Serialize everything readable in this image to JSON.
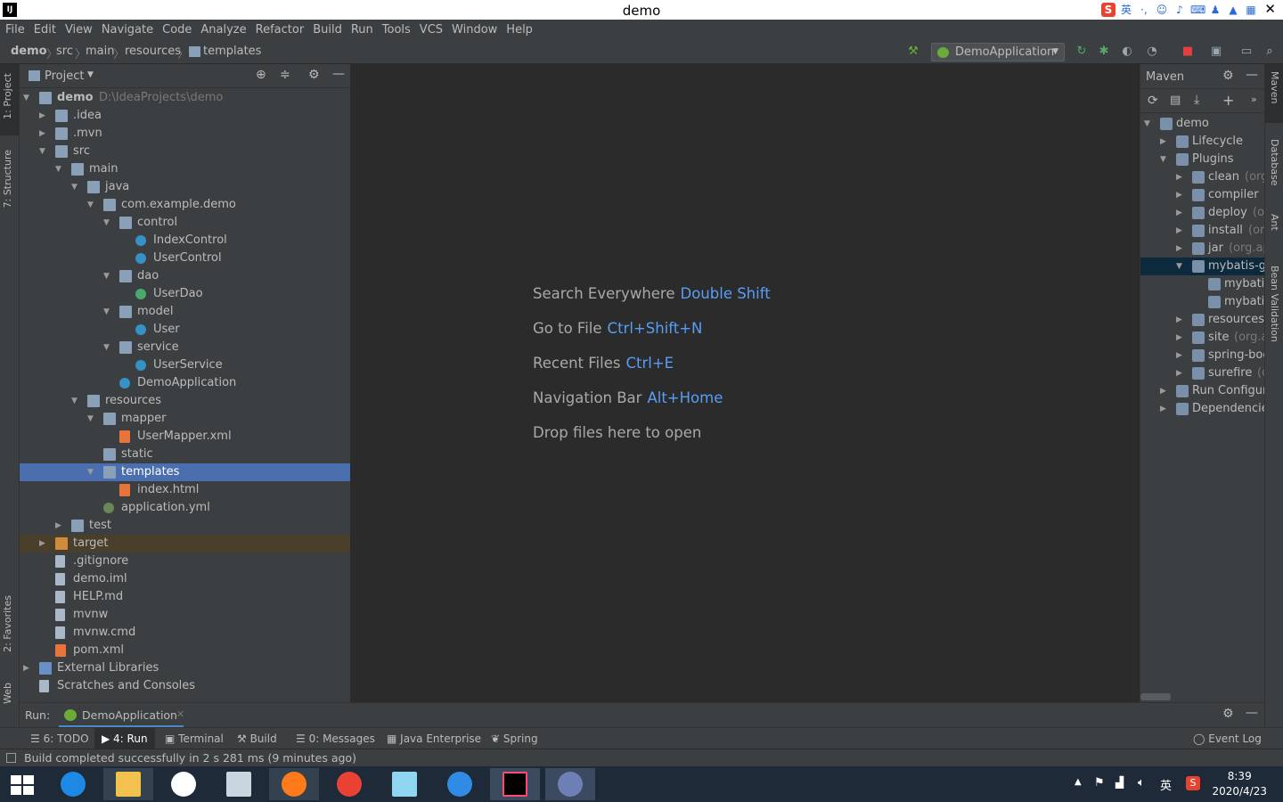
{
  "window": {
    "title": "demo"
  },
  "menu": [
    "File",
    "Edit",
    "View",
    "Navigate",
    "Code",
    "Analyze",
    "Refactor",
    "Build",
    "Run",
    "Tools",
    "VCS",
    "Window",
    "Help"
  ],
  "breadcrumb": [
    "demo",
    "src",
    "main",
    "resources",
    "templates"
  ],
  "run_config": "DemoApplication",
  "left_tabs": {
    "project": "1: Project",
    "structure": "7: Structure",
    "favorites": "2: Favorites",
    "web": "Web"
  },
  "project_panel": {
    "title": "Project",
    "tree": [
      {
        "label": "demo",
        "extra": "D:\\IdeaProjects\\demo",
        "depth": 0,
        "open": true,
        "type": "module"
      },
      {
        "label": ".idea",
        "depth": 1,
        "open": false,
        "type": "folder"
      },
      {
        "label": ".mvn",
        "depth": 1,
        "open": false,
        "type": "folder"
      },
      {
        "label": "src",
        "depth": 1,
        "open": true,
        "type": "folder"
      },
      {
        "label": "main",
        "depth": 2,
        "open": true,
        "type": "folder"
      },
      {
        "label": "java",
        "depth": 3,
        "open": true,
        "type": "folder"
      },
      {
        "label": "com.example.demo",
        "depth": 4,
        "open": true,
        "type": "folder"
      },
      {
        "label": "control",
        "depth": 5,
        "open": true,
        "type": "folder"
      },
      {
        "label": "IndexControl",
        "depth": 6,
        "type": "class"
      },
      {
        "label": "UserControl",
        "depth": 6,
        "type": "class"
      },
      {
        "label": "dao",
        "depth": 5,
        "open": true,
        "type": "folder"
      },
      {
        "label": "UserDao",
        "depth": 6,
        "type": "iface"
      },
      {
        "label": "model",
        "depth": 5,
        "open": true,
        "type": "folder"
      },
      {
        "label": "User",
        "depth": 6,
        "type": "class"
      },
      {
        "label": "service",
        "depth": 5,
        "open": true,
        "type": "folder"
      },
      {
        "label": "UserService",
        "depth": 6,
        "type": "class"
      },
      {
        "label": "DemoApplication",
        "depth": 5,
        "type": "class"
      },
      {
        "label": "resources",
        "depth": 3,
        "open": true,
        "type": "folder"
      },
      {
        "label": "mapper",
        "depth": 4,
        "open": true,
        "type": "folder"
      },
      {
        "label": "UserMapper.xml",
        "depth": 5,
        "type": "xml"
      },
      {
        "label": "static",
        "depth": 4,
        "type": "folder"
      },
      {
        "label": "templates",
        "depth": 4,
        "open": true,
        "type": "folder",
        "selected": true
      },
      {
        "label": "index.html",
        "depth": 5,
        "type": "html"
      },
      {
        "label": "application.yml",
        "depth": 4,
        "type": "yml"
      },
      {
        "label": "test",
        "depth": 2,
        "open": false,
        "type": "folder"
      },
      {
        "label": "target",
        "depth": 1,
        "open": false,
        "type": "folder-orange",
        "excluded": true
      },
      {
        "label": ".gitignore",
        "depth": 1,
        "type": "file"
      },
      {
        "label": "demo.iml",
        "depth": 1,
        "type": "file"
      },
      {
        "label": "HELP.md",
        "depth": 1,
        "type": "file"
      },
      {
        "label": "mvnw",
        "depth": 1,
        "type": "file"
      },
      {
        "label": "mvnw.cmd",
        "depth": 1,
        "type": "file"
      },
      {
        "label": "pom.xml",
        "depth": 1,
        "type": "xml"
      },
      {
        "label": "External Libraries",
        "depth": 0,
        "open": false,
        "type": "lib"
      },
      {
        "label": "Scratches and Consoles",
        "depth": 0,
        "type": "file"
      }
    ]
  },
  "editor_hints": [
    {
      "text": "Search Everywhere",
      "key": "Double Shift"
    },
    {
      "text": "Go to File",
      "key": "Ctrl+Shift+N"
    },
    {
      "text": "Recent Files",
      "key": "Ctrl+E"
    },
    {
      "text": "Navigation Bar",
      "key": "Alt+Home"
    },
    {
      "text": "Drop files here to open",
      "key": ""
    }
  ],
  "maven": {
    "title": "Maven",
    "tree": [
      {
        "label": "demo",
        "depth": 0,
        "open": true
      },
      {
        "label": "Lifecycle",
        "depth": 1,
        "open": false
      },
      {
        "label": "Plugins",
        "depth": 1,
        "open": true
      },
      {
        "label": "clean",
        "extra": "(org.",
        "depth": 2,
        "open": false
      },
      {
        "label": "compiler",
        "extra": "(c",
        "depth": 2,
        "open": false
      },
      {
        "label": "deploy",
        "extra": "(or",
        "depth": 2,
        "open": false
      },
      {
        "label": "install",
        "extra": "(org.",
        "depth": 2,
        "open": false
      },
      {
        "label": "jar",
        "extra": "(org.ap",
        "depth": 2,
        "open": false
      },
      {
        "label": "mybatis-ge",
        "depth": 2,
        "open": true,
        "selected": true
      },
      {
        "label": "mybatis",
        "depth": 3
      },
      {
        "label": "mybatis",
        "depth": 3
      },
      {
        "label": "resources",
        "extra": "(",
        "depth": 2,
        "open": false
      },
      {
        "label": "site",
        "extra": "(org.ap",
        "depth": 2,
        "open": false
      },
      {
        "label": "spring-boc",
        "depth": 2,
        "open": false
      },
      {
        "label": "surefire",
        "extra": "(or",
        "depth": 2,
        "open": false
      },
      {
        "label": "Run Configura",
        "depth": 1,
        "open": false
      },
      {
        "label": "Dependencies",
        "depth": 1,
        "open": false
      }
    ]
  },
  "right_tabs": [
    "Maven",
    "Database",
    "Ant",
    "Bean Validation"
  ],
  "run_bar": {
    "label": "Run:",
    "tab": "DemoApplication"
  },
  "tool_windows": [
    "6: TODO",
    "4: Run",
    "Terminal",
    "Build",
    "0: Messages",
    "Java Enterprise",
    "Spring"
  ],
  "event_log": "Event Log",
  "status": "Build completed successfully in 2 s 281 ms (9 minutes ago)",
  "ime": {
    "lang": "英"
  },
  "clock": {
    "time": "8:39",
    "date": "2020/4/23"
  },
  "tray_lang": "英",
  "colors": {
    "accent": "#589df6",
    "selection": "#4b6eaf",
    "bg": "#2b2b2b",
    "panel": "#3c3f41"
  }
}
